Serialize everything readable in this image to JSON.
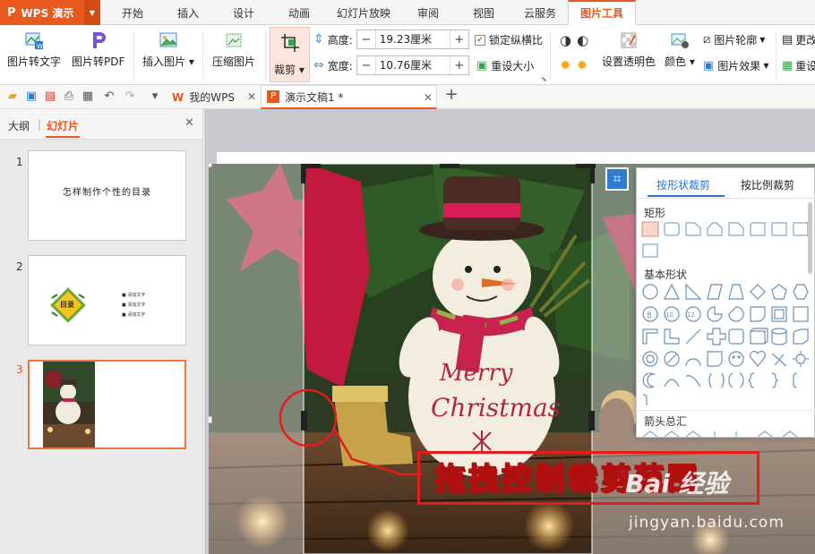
{
  "app": {
    "name": "WPS 演示",
    "logo_glyph": "P",
    "accent": "#e8591e"
  },
  "ribbon_tabs": [
    "开始",
    "插入",
    "设计",
    "动画",
    "幻灯片放映",
    "审阅",
    "视图",
    "云服务",
    "图片工具"
  ],
  "ribbon_active_tab": "图片工具",
  "ribbon": {
    "pic_to_text": "图片转文字",
    "pic_to_pdf": "图片转PDF",
    "insert_pic": "插入图片",
    "compress_pic": "压缩图片",
    "crop": "裁剪",
    "height_label": "高度:",
    "height_value": "19.23厘米",
    "width_label": "宽度:",
    "width_value": "10.76厘米",
    "lock_ratio": "锁定纵横比",
    "reset_size": "重设大小",
    "set_transparent": "设置透明色",
    "color": "颜色",
    "outline": "图片轮廓",
    "effect": "图片效果",
    "more": "更改",
    "reset": "重设"
  },
  "doc_tabs": [
    {
      "label": "我的WPS",
      "icon": "W"
    },
    {
      "label": "演示文稿1 *",
      "icon": "P"
    }
  ],
  "left_panel": {
    "tabs": [
      "大纲",
      "幻灯片"
    ],
    "active_tab": "幻灯片",
    "slides": [
      {
        "num": "1",
        "title": "怎样制作个性的目录"
      },
      {
        "num": "2",
        "badge": "目录",
        "lines": [
          "■ 添加文字",
          "■ 添加文字",
          "■ 添加文字"
        ]
      },
      {
        "num": "3"
      }
    ]
  },
  "flyout": {
    "tabs": [
      "按形状裁剪",
      "按比例裁剪"
    ],
    "active_tab": "按形状裁剪",
    "sections": [
      "矩形",
      "基本形状",
      "箭头总汇"
    ],
    "basic_shape_labels": [
      "8",
      "10",
      "12"
    ]
  },
  "annotation": {
    "text": "拖拽控制裁剪范围",
    "color": "#e31c1c"
  },
  "watermark": {
    "brand": "Bai 经验",
    "url": "jingyan.baidu.com"
  }
}
